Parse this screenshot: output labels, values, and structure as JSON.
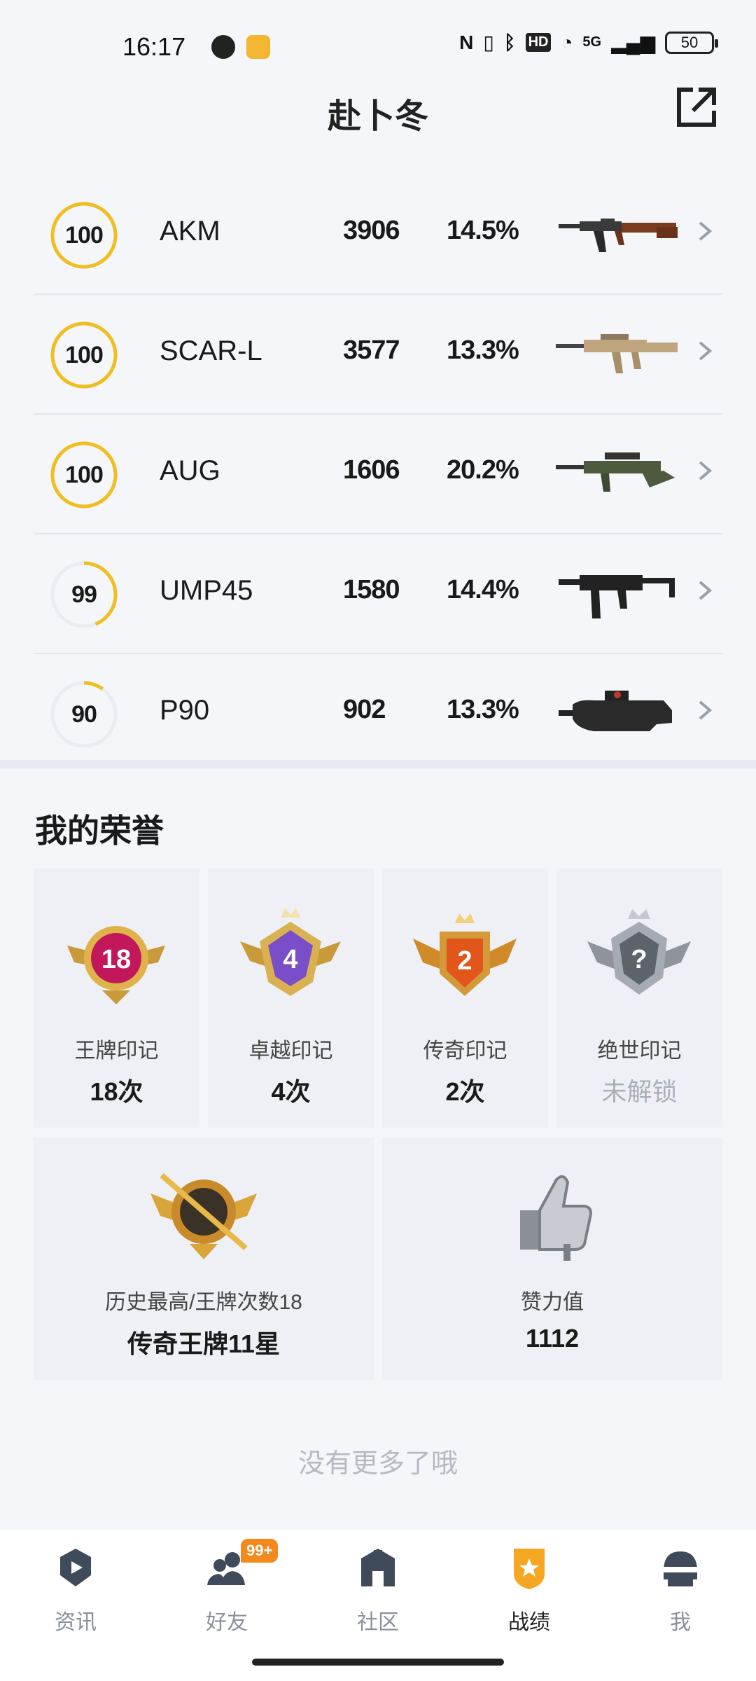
{
  "status_bar": {
    "time": "16:17",
    "network": "5G",
    "hd": "HD",
    "battery": "50"
  },
  "header": {
    "title": "赴卜冬"
  },
  "weapons": [
    {
      "score": "100",
      "score_value": 100,
      "name": "AKM",
      "kills": "3906",
      "rate": "14.5%"
    },
    {
      "score": "100",
      "score_value": 100,
      "name": "SCAR-L",
      "kills": "3577",
      "rate": "13.3%"
    },
    {
      "score": "100",
      "score_value": 100,
      "name": "AUG",
      "kills": "1606",
      "rate": "20.2%"
    },
    {
      "score": "99",
      "score_value": 99,
      "name": "UMP45",
      "kills": "1580",
      "rate": "14.4%"
    },
    {
      "score": "90",
      "score_value": 90,
      "name": "P90",
      "kills": "902",
      "rate": "13.3%"
    }
  ],
  "honor": {
    "title": "我的荣誉",
    "cards": [
      {
        "label": "王牌印记",
        "value": "18次",
        "badge_number": "18"
      },
      {
        "label": "卓越印记",
        "value": "4次",
        "badge_number": "4"
      },
      {
        "label": "传奇印记",
        "value": "2次",
        "badge_number": "2"
      },
      {
        "label": "绝世印记",
        "value": "未解锁",
        "badge_number": "?"
      }
    ],
    "stats": [
      {
        "label": "历史最高/王牌次数18",
        "value": "传奇王牌11星"
      },
      {
        "label": "赞力值",
        "value": "1112"
      }
    ]
  },
  "footer_text": "没有更多了哦",
  "nav": {
    "items": [
      {
        "label": "资讯"
      },
      {
        "label": "好友",
        "badge": "99+"
      },
      {
        "label": "社区"
      },
      {
        "label": "战绩"
      },
      {
        "label": "我"
      }
    ]
  },
  "colors": {
    "ring": "#f2bd1e",
    "accent": "#f5a623",
    "badge": "#f58a1c"
  }
}
